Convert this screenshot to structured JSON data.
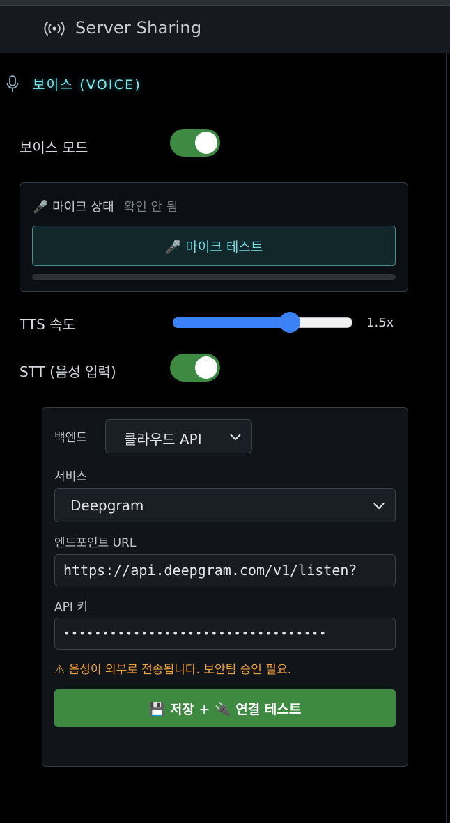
{
  "header": {
    "title": "Server Sharing",
    "icon": "broadcast-icon"
  },
  "voice_section": {
    "label": "보이스 (VOICE)",
    "icon": "microphone-icon"
  },
  "voice_mode": {
    "label": "보이스 모드",
    "enabled": true
  },
  "mic": {
    "status_label": "🎤 마이크 상태",
    "status_value": "확인 안 됨",
    "test_button": "🎤 마이크 테스트",
    "level": 0
  },
  "tts": {
    "label": "TTS 속도",
    "value_text": "1.5x",
    "value": 1.5,
    "fraction": 0.65
  },
  "stt": {
    "label": "STT (음성 입력)",
    "enabled": true
  },
  "stt_panel": {
    "backend_label": "백엔드",
    "backend_value": "클라우드 API",
    "service_label": "서비스",
    "service_value": "Deepgram",
    "endpoint_label": "엔드포인트 URL",
    "endpoint_value": "https://api.deepgram.com/v1/listen?",
    "apikey_label": "API 키",
    "apikey_value": "••••••••••••••••••••••••••••••••••",
    "warning": "⚠ 음성이 외부로 전송됩니다. 보안팀 승인 필요.",
    "save_button": "💾 저장 + 🔌 연결 테스트"
  },
  "colors": {
    "accent_cyan": "#7de8ef",
    "toggle_on": "#3f8a42",
    "slider_blue": "#3b82f6",
    "warning_orange": "#f0a13a",
    "save_green": "#3e8a41"
  }
}
